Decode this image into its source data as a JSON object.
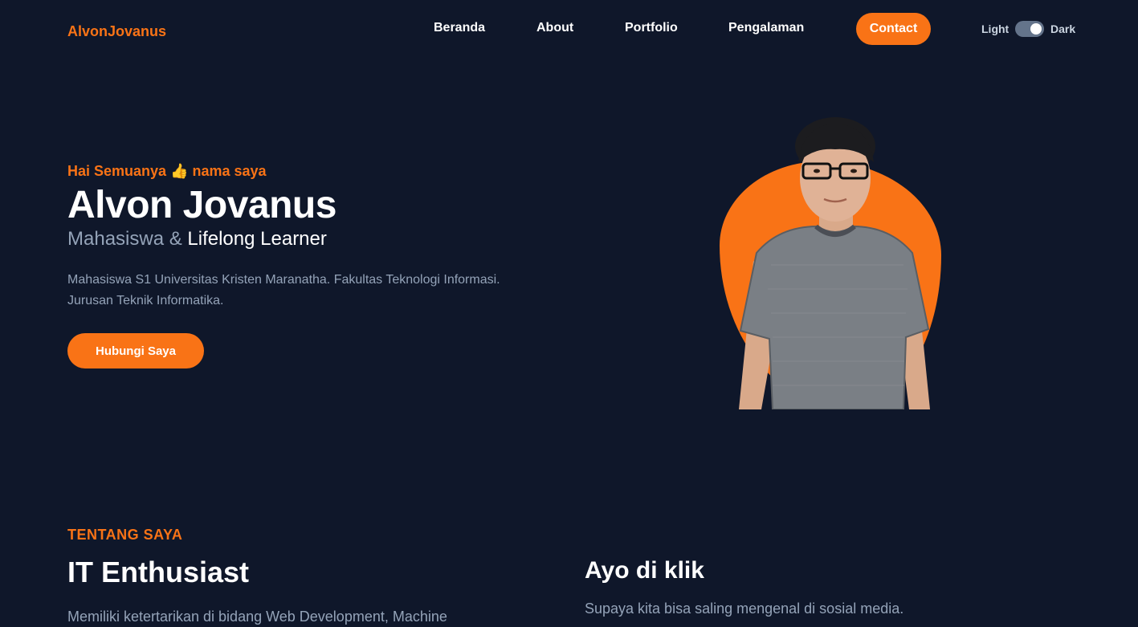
{
  "navbar": {
    "logo": "AlvonJovanus",
    "links": [
      "Beranda",
      "About",
      "Portfolio",
      "Pengalaman"
    ],
    "contact": "Contact",
    "theme_light": "Light",
    "theme_dark": "Dark",
    "theme_is_dark": true
  },
  "hero": {
    "greeting": "Hai Semuanya 👍 nama saya",
    "name": "Alvon Jovanus",
    "role_prefix": "Mahasiswa &",
    "role_highlight": "Lifelong Learner",
    "description_line1": "Mahasiswa S1 Universitas Kristen Maranatha. Fakultas Teknologi Informasi.",
    "description_line2": "Jurusan Teknik Informatika.",
    "button": "Hubungi Saya"
  },
  "about": {
    "tag": "TENTANG SAYA",
    "title": "IT Enthusiast",
    "description": "Memiliki ketertarikan di bidang Web Development, Machine",
    "social_title": "Ayo di klik",
    "social_description": "Supaya kita bisa saling mengenal di sosial media."
  },
  "colors": {
    "background": "#0f172a",
    "accent": "#f97316",
    "muted_text": "#94a3b8"
  }
}
